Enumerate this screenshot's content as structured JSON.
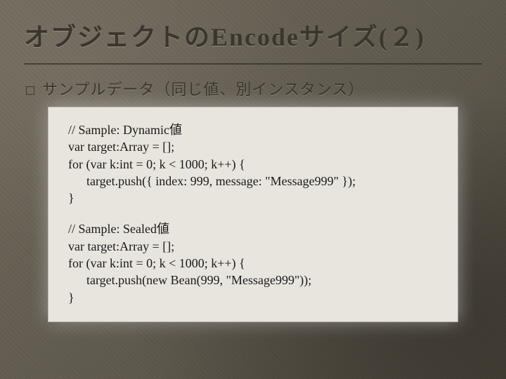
{
  "title": "オブジェクトのEncodeサイズ(２)",
  "bullet": {
    "glyph": "□",
    "text": "サンプルデータ（同じ値、別インスタンス）"
  },
  "code": {
    "block1": {
      "l1": "// Sample: Dynamic値",
      "l2": "var target:Array = [];",
      "l3": "for (var k:int = 0; k < 1000; k++) {",
      "l4": "target.push({ index: 999, message: \"Message999\" });",
      "l5": "}"
    },
    "block2": {
      "l1": "// Sample: Sealed値",
      "l2": "var target:Array = [];",
      "l3": "for (var k:int = 0; k < 1000; k++) {",
      "l4": "target.push(new Bean(999, \"Message999\"));",
      "l5": "}"
    }
  }
}
